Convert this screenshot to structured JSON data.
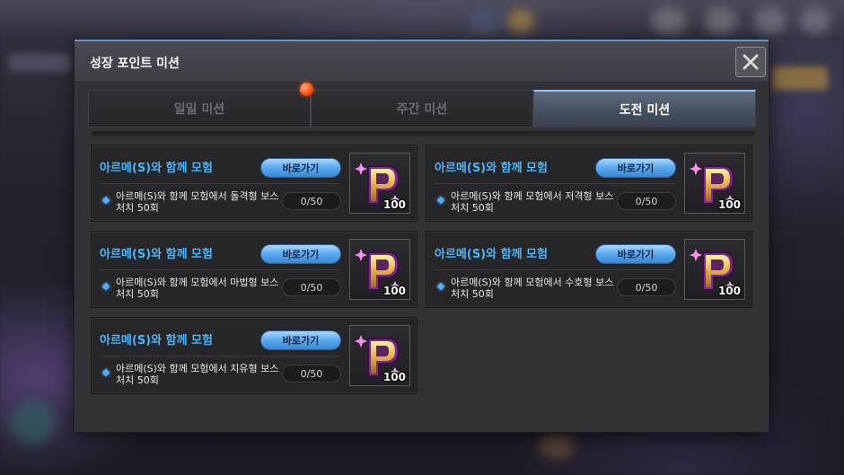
{
  "dialog": {
    "title": "성장 포인트 미션",
    "close_icon": "close-icon"
  },
  "tabs": [
    {
      "label": "일일 미션",
      "active": false
    },
    {
      "label": "주간 미션",
      "active": false
    },
    {
      "label": "도전 미션",
      "active": true
    }
  ],
  "missions": [
    {
      "title": "아르메(S)와 함께 모험",
      "button": "바로가기",
      "desc": "아르메(S)와 함께 모험에서 돌격형 보스 처치 50회",
      "progress": "0/50",
      "reward_icon": "growth-point-p-icon",
      "reward_qty": "100"
    },
    {
      "title": "아르메(S)와 함께 모험",
      "button": "바로가기",
      "desc": "아르메(S)와 함께 모험에서 저격형 보스 처치 50회",
      "progress": "0/50",
      "reward_icon": "growth-point-p-icon",
      "reward_qty": "100"
    },
    {
      "title": "아르메(S)와 함께 모험",
      "button": "바로가기",
      "desc": "아르메(S)와 함께 모험에서 마법형 보스 처치 50회",
      "progress": "0/50",
      "reward_icon": "growth-point-p-icon",
      "reward_qty": "100"
    },
    {
      "title": "아르메(S)와 함께 모험",
      "button": "바로가기",
      "desc": "아르메(S)와 함께 모험에서 수호형 보스 처치 50회",
      "progress": "0/50",
      "reward_icon": "growth-point-p-icon",
      "reward_qty": "100"
    },
    {
      "title": "아르메(S)와 함께 모험",
      "button": "바로가기",
      "desc": "아르메(S)와 함께 모험에서 치유형 보스 처치 50회",
      "progress": "0/50",
      "reward_icon": "growth-point-p-icon",
      "reward_qty": "100"
    }
  ],
  "colors": {
    "accent_blue": "#46b6ff",
    "active_tab_border": "#8ec5ff",
    "notification_dot": "#ff4a10",
    "button_blue": "#5aa8ee"
  }
}
